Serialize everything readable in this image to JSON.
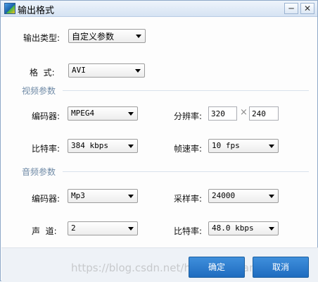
{
  "window": {
    "title": "输出格式",
    "minimize_glyph": "─",
    "close_glyph": "✕"
  },
  "output": {
    "type_label": "输出类型:",
    "type_value": "自定义参数",
    "format_label": "格  式:",
    "format_value": "AVI"
  },
  "video": {
    "section_title": "视频参数",
    "encoder_label": "编码器:",
    "encoder_value": "MPEG4",
    "resolution_label": "分辨率:",
    "width_value": "320",
    "times_glyph": "×",
    "height_value": "240",
    "bitrate_label": "比特率:",
    "bitrate_value": "384 kbps",
    "framerate_label": "帧速率:",
    "framerate_value": "10 fps"
  },
  "audio": {
    "section_title": "音频参数",
    "encoder_label": "编码器:",
    "encoder_value": "Mp3",
    "samplerate_label": "采样率:",
    "samplerate_value": "24000",
    "channels_label": "声  道:",
    "channels_value": "2",
    "bitrate_label": "比特率:",
    "bitrate_value": "48.0 kbps"
  },
  "buttons": {
    "ok": "确定",
    "cancel": "取消"
  },
  "watermark": "https://blog.csdn.net/huangbaoliang",
  "colors": {
    "button_blue": "#1f6cbf",
    "section_text": "#6f8aa6"
  }
}
